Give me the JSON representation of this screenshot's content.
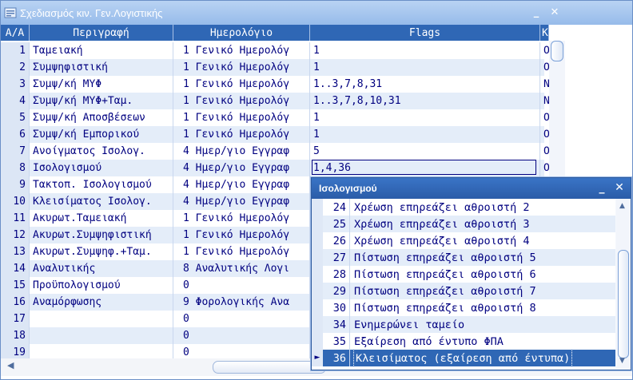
{
  "window": {
    "title": "Σχεδιασμός κιν. Γεν.Λογιστικής"
  },
  "columns": {
    "aa": "Α/Α",
    "desc": "Περιγραφή",
    "journal": "Ημερολόγιο",
    "flags": "Flags",
    "k": "Κ"
  },
  "rows": [
    {
      "aa": "1",
      "desc": "Ταμειακή",
      "journal": "1 Γενικό Ημερολόγ",
      "flags": "1",
      "k": "Ο"
    },
    {
      "aa": "2",
      "desc": "Συμψηφιστική",
      "journal": "1 Γενικό Ημερολόγ",
      "flags": "1",
      "k": "Ο"
    },
    {
      "aa": "3",
      "desc": "Συμψ/κή ΜΥΦ",
      "journal": "1 Γενικό Ημερολόγ",
      "flags": "1..3,7,8,31",
      "k": "Ν"
    },
    {
      "aa": "4",
      "desc": "Συμψ/κή ΜΥΦ+Ταμ.",
      "journal": "1 Γενικό Ημερολόγ",
      "flags": "1..3,7,8,10,31",
      "k": "Ν"
    },
    {
      "aa": "5",
      "desc": "Συμψ/κή Αποσβέσεων",
      "journal": "1 Γενικό Ημερολόγ",
      "flags": "1",
      "k": "Ο"
    },
    {
      "aa": "6",
      "desc": "Συμψ/κή Εμπορικού",
      "journal": "1 Γενικό Ημερολόγ",
      "flags": "1",
      "k": "Ο"
    },
    {
      "aa": "7",
      "desc": "Ανοίγματος Ισολογ.",
      "journal": "4 Ημερ/γιο Εγγραφ",
      "flags": "5",
      "k": "Ο"
    },
    {
      "aa": "8",
      "desc": "Ισολογισμού",
      "journal": "4 Ημερ/γιο Εγγραφ",
      "flags": "1,4,36",
      "k": "Ο"
    },
    {
      "aa": "9",
      "desc": "Τακτοπ. Ισολογισμού",
      "journal": "4 Ημερ/γιο Εγγραφ",
      "flags": "",
      "k": ""
    },
    {
      "aa": "10",
      "desc": "Κλεισίματος Ισολογ.",
      "journal": "4 Ημερ/γιο Εγγραφ",
      "flags": "",
      "k": ""
    },
    {
      "aa": "11",
      "desc": "Ακυρωτ.Ταμειακή",
      "journal": "1 Γενικό Ημερολόγ",
      "flags": "",
      "k": ""
    },
    {
      "aa": "12",
      "desc": "Ακυρωτ.Συμψηφιστική",
      "journal": "1 Γενικό Ημερολόγ",
      "flags": "",
      "k": ""
    },
    {
      "aa": "13",
      "desc": "Ακυρωτ.Συμψηφ.+Ταμ.",
      "journal": "1 Γενικό Ημερολόγ",
      "flags": "",
      "k": ""
    },
    {
      "aa": "14",
      "desc": "Αναλυτικής",
      "journal": "8 Αναλυτικής Λογι",
      "flags": "",
      "k": ""
    },
    {
      "aa": "15",
      "desc": "Προϋπολογισμού",
      "journal": "0",
      "flags": "",
      "k": ""
    },
    {
      "aa": "16",
      "desc": "Αναμόρφωσης",
      "journal": "9 Φορολογικής Ανα",
      "flags": "",
      "k": ""
    },
    {
      "aa": "17",
      "desc": "",
      "journal": "0",
      "flags": "",
      "k": ""
    },
    {
      "aa": "18",
      "desc": "",
      "journal": "0",
      "flags": "",
      "k": ""
    },
    {
      "aa": "19",
      "desc": "",
      "journal": "0",
      "flags": "",
      "k": ""
    }
  ],
  "popup": {
    "title": "Ισολογισμού",
    "items": [
      {
        "num": "24",
        "label": "Χρέωση επηρεάζει αθροιστή 2"
      },
      {
        "num": "25",
        "label": "Χρέωση επηρεάζει αθροιστή 3"
      },
      {
        "num": "26",
        "label": "Χρέωση επηρεάζει αθροιστή 4"
      },
      {
        "num": "27",
        "label": "Πίστωση επηρεάζει αθροιστή 5"
      },
      {
        "num": "28",
        "label": "Πίστωση επηρεάζει αθροιστή 6"
      },
      {
        "num": "29",
        "label": "Πίστωση επηρεάζει αθροιστή 7"
      },
      {
        "num": "30",
        "label": "Πίστωση επηρεάζει αθροιστή 8"
      },
      {
        "num": "34",
        "label": "Ενημερώνει ταμείο"
      },
      {
        "num": "35",
        "label": "Εξαίρεση από έντυπο ΦΠΑ"
      },
      {
        "num": "36",
        "label": "Κλεισίματος (εξαίρεση από έντυπα)"
      }
    ],
    "selected_index": 9
  },
  "colors": {
    "header": "#2f67b5",
    "text": "#000080",
    "alt_row": "#e4edf9",
    "selection": "#2f67b5"
  }
}
